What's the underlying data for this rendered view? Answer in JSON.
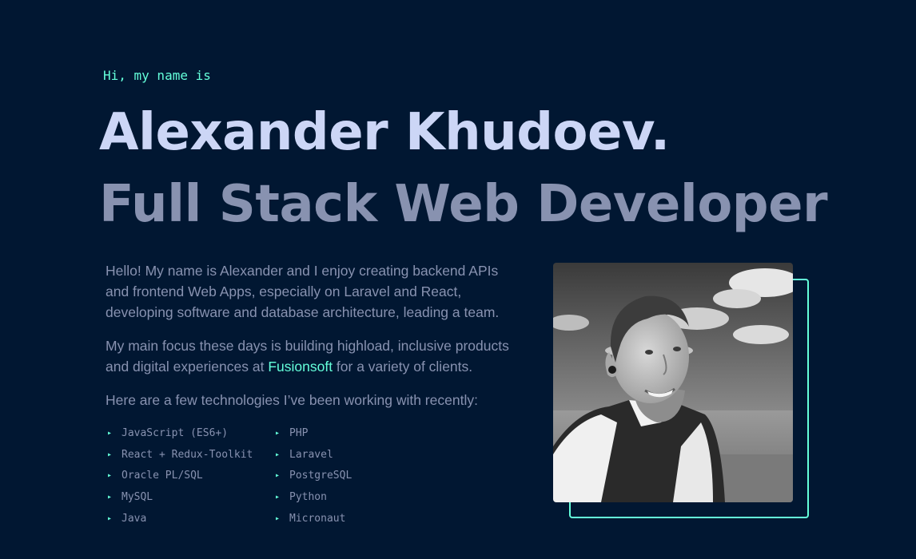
{
  "hero": {
    "greeting": "Hi, my name is",
    "name": "Alexander Khudoev.",
    "role": "Full Stack Web Developer"
  },
  "about": {
    "paragraph1": "Hello! My name is Alexander and I enjoy creating backend APIs and frontend Web Apps, especially on Laravel and React, developing software and database architecture, leading a team.",
    "paragraph2_before": "My main focus these days is building highload, inclusive products and digital experiences at ",
    "paragraph2_link": "Fusionsoft",
    "paragraph2_after": " for a variety of clients.",
    "paragraph3": "Here are a few technologies I’ve been working with recently:"
  },
  "technologies": {
    "bullet": "▸",
    "items": [
      "JavaScript (ES6+)",
      "PHP",
      "React + Redux-Toolkit",
      "Laravel",
      "Oracle PL/SQL",
      "PostgreSQL",
      "MySQL",
      "Python",
      "Java",
      "Micronaut"
    ]
  },
  "photo": {
    "subject": "profile-photo"
  },
  "colors": {
    "background": "#011732",
    "accent": "#64ffda",
    "heading": "#ccd6f6",
    "text": "#8892b0"
  }
}
